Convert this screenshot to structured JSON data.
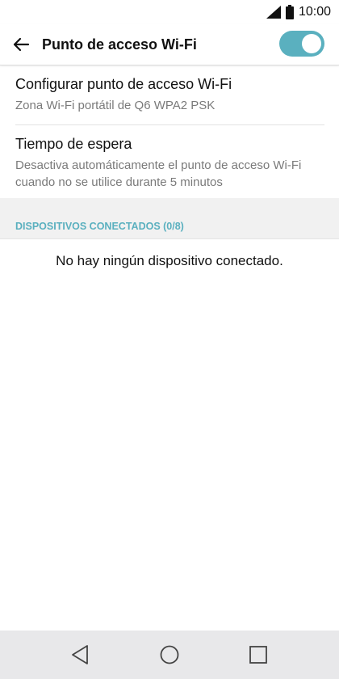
{
  "status_bar": {
    "time": "10:00",
    "icons": [
      "signal-icon",
      "battery-icon"
    ]
  },
  "app_bar": {
    "title": "Punto de acceso Wi-Fi",
    "back_icon": "arrow-left-icon",
    "hotspot_toggle_on": true
  },
  "settings": [
    {
      "title": "Configurar punto de acceso Wi-Fi",
      "subtitle": "Zona Wi-Fi portátil de Q6 WPA2 PSK"
    },
    {
      "title": "Tiempo de espera",
      "subtitle": "Desactiva automáticamente el punto de acceso Wi-Fi cuando no se utilice durante 5 minutos"
    }
  ],
  "connected_devices": {
    "header": "DISPOSITIVOS CONECTADOS (0/8)",
    "empty_message": "No hay ningún dispositivo conectado."
  },
  "nav_bar": {
    "icons": [
      "nav-back-icon",
      "nav-home-icon",
      "nav-recent-apps-icon"
    ]
  },
  "colors": {
    "accent": "#5ab0bf",
    "nav_bar_bg": "#e8e8ea",
    "section_bg": "#f1f1f1"
  }
}
